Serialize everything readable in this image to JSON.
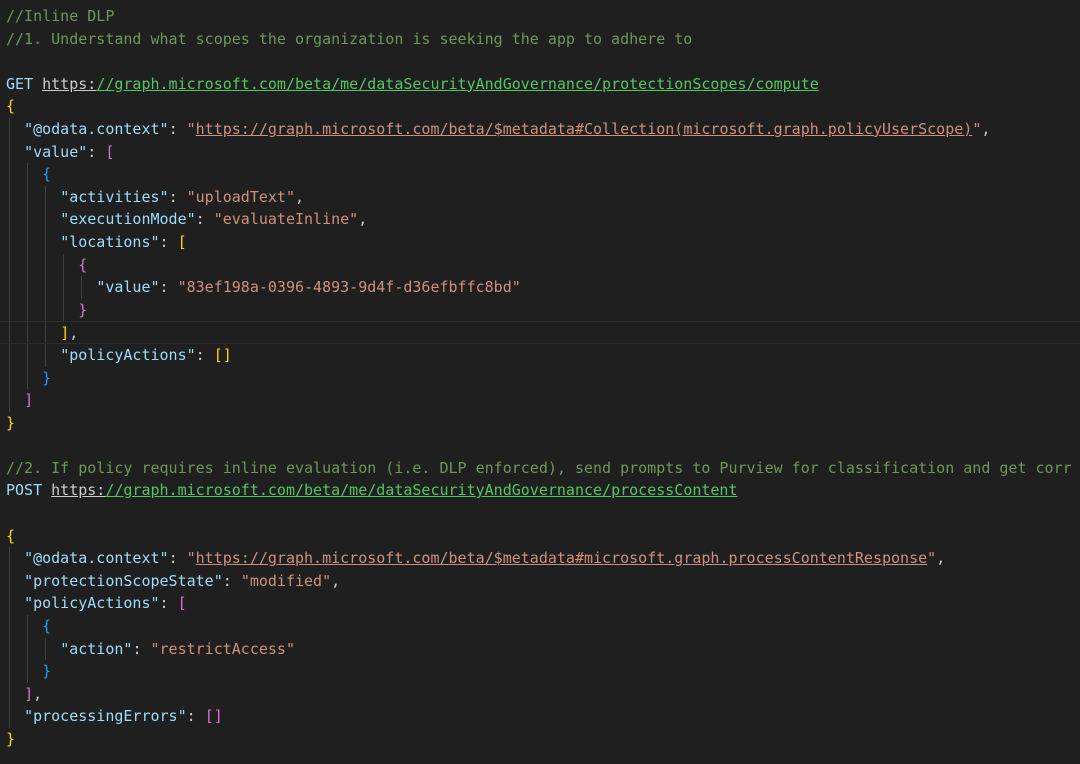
{
  "lines": [
    "//Inline DLP",
    "//1. Understand what scopes the organization is seeking the app to adhere to",
    "",
    "GET https://graph.microsoft.com/beta/me/dataSecurityAndGovernance/protectionScopes/compute",
    "{",
    "  \"@odata.context\": \"https://graph.microsoft.com/beta/$metadata#Collection(microsoft.graph.policyUserScope)\",",
    "  \"value\": [",
    "    {",
    "      \"activities\": \"uploadText\",",
    "      \"executionMode\": \"evaluateInline\",",
    "      \"locations\": [",
    "        {",
    "          \"value\": \"83ef198a-0396-4893-9d4f-d36efbffc8bd\"",
    "        }",
    "      ],",
    "      \"policyActions\": []",
    "    }",
    "  ]",
    "}",
    "",
    "//2. If policy requires inline evaluation (i.e. DLP enforced), send prompts to Purview for classification and get corr",
    "POST https://graph.microsoft.com/beta/me/dataSecurityAndGovernance/processContent",
    "",
    "{",
    "  \"@odata.context\": \"https://graph.microsoft.com/beta/$metadata#microsoft.graph.processContentResponse\",",
    "  \"protectionScopeState\": \"modified\",",
    "  \"policyActions\": [",
    "    {",
    "      \"action\": \"restrictAccess\"",
    "    }",
    "  ],",
    "  \"processingErrors\": []",
    "}"
  ],
  "current_line": 14,
  "syntax_colors": {
    "comment": "#6a9955",
    "key": "#9cdcfe",
    "string": "#ce9178",
    "url_link": "#4ec960",
    "bracket_level_1": "#ffd700",
    "bracket_level_2": "#da70d6",
    "bracket_level_3": "#179fff",
    "background": "#1f1f1f"
  }
}
